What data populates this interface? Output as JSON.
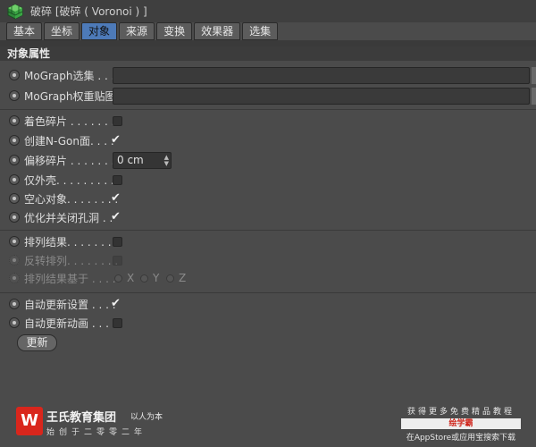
{
  "window": {
    "title": "破碎 [破碎 ( Voronoi ) ]"
  },
  "tabs": [
    {
      "label": "基本",
      "active": false
    },
    {
      "label": "坐标",
      "active": false
    },
    {
      "label": "对象",
      "active": true
    },
    {
      "label": "来源",
      "active": false
    },
    {
      "label": "变换",
      "active": false
    },
    {
      "label": "效果器",
      "active": false
    },
    {
      "label": "选集",
      "active": false
    }
  ],
  "section": {
    "title": "对象属性"
  },
  "fields": {
    "mograph_selection": {
      "label": "MoGraph选集 . . .",
      "value": ""
    },
    "mograph_weightmap": {
      "label": "MoGraph权重贴图",
      "value": ""
    }
  },
  "options": {
    "color_fragments": {
      "label": "着色碎片 . . . . . . . .",
      "checked": false
    },
    "create_ngon": {
      "label": "创建N-Gon面. . . .",
      "checked": true
    },
    "offset_fragments": {
      "label": "偏移碎片 . . . . . . . . .",
      "value": "0 cm"
    },
    "outer_shell": {
      "label": "仅外壳. . . . . . . . . .",
      "checked": false
    },
    "hollow_object": {
      "label": "空心对象. . . . . . . .",
      "checked": true
    },
    "optimize_close_holes": {
      "label": "优化并关闭孔洞 . .",
      "checked": true
    },
    "sort_results": {
      "label": "排列结果. . . . . . . .",
      "checked": false
    },
    "invert_sort": {
      "label": "反转排列. . . . . . . .",
      "checked": false,
      "disabled": true
    },
    "sort_based_on": {
      "label": "排列结果基于 . . . .",
      "disabled": true,
      "axes": [
        "X",
        "Y",
        "Z"
      ],
      "selected": "X"
    },
    "auto_update_settings": {
      "label": "自动更新设置 . . . .",
      "checked": true
    },
    "auto_update_animation": {
      "label": "自动更新动画 . . . .",
      "checked": false
    }
  },
  "update_button": {
    "label": "更新"
  },
  "watermark": {
    "logo_glyph": "W",
    "brand_name": "王氏教育集团",
    "slogan": "以人为本",
    "sub": "始创于二零零二年",
    "right_line1": "获得更多免费精品教程",
    "right_line2": "绘学霸",
    "right_line3": "在AppStore或应用宝搜索下载",
    "logo_color": "#d9261c"
  },
  "colors": {
    "active_tab": "#4d7ab8",
    "background": "#4b4b4b"
  }
}
